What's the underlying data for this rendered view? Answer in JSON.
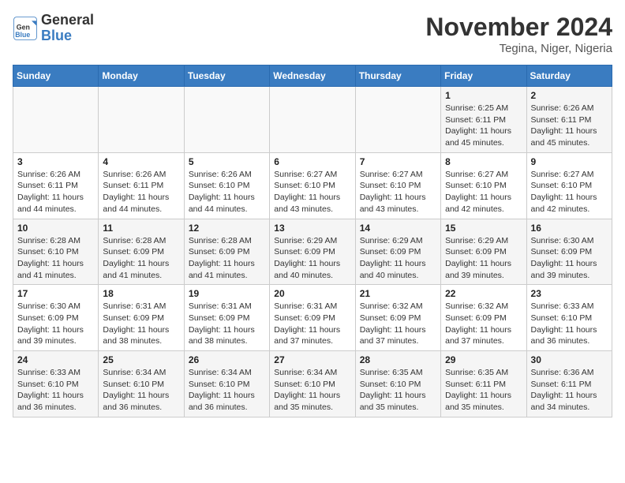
{
  "logo": {
    "general": "General",
    "blue": "Blue"
  },
  "header": {
    "title": "November 2024",
    "location": "Tegina, Niger, Nigeria"
  },
  "weekdays": [
    "Sunday",
    "Monday",
    "Tuesday",
    "Wednesday",
    "Thursday",
    "Friday",
    "Saturday"
  ],
  "weeks": [
    [
      {
        "day": "",
        "info": ""
      },
      {
        "day": "",
        "info": ""
      },
      {
        "day": "",
        "info": ""
      },
      {
        "day": "",
        "info": ""
      },
      {
        "day": "",
        "info": ""
      },
      {
        "day": "1",
        "info": "Sunrise: 6:25 AM\nSunset: 6:11 PM\nDaylight: 11 hours\nand 45 minutes."
      },
      {
        "day": "2",
        "info": "Sunrise: 6:26 AM\nSunset: 6:11 PM\nDaylight: 11 hours\nand 45 minutes."
      }
    ],
    [
      {
        "day": "3",
        "info": "Sunrise: 6:26 AM\nSunset: 6:11 PM\nDaylight: 11 hours\nand 44 minutes."
      },
      {
        "day": "4",
        "info": "Sunrise: 6:26 AM\nSunset: 6:11 PM\nDaylight: 11 hours\nand 44 minutes."
      },
      {
        "day": "5",
        "info": "Sunrise: 6:26 AM\nSunset: 6:10 PM\nDaylight: 11 hours\nand 44 minutes."
      },
      {
        "day": "6",
        "info": "Sunrise: 6:27 AM\nSunset: 6:10 PM\nDaylight: 11 hours\nand 43 minutes."
      },
      {
        "day": "7",
        "info": "Sunrise: 6:27 AM\nSunset: 6:10 PM\nDaylight: 11 hours\nand 43 minutes."
      },
      {
        "day": "8",
        "info": "Sunrise: 6:27 AM\nSunset: 6:10 PM\nDaylight: 11 hours\nand 42 minutes."
      },
      {
        "day": "9",
        "info": "Sunrise: 6:27 AM\nSunset: 6:10 PM\nDaylight: 11 hours\nand 42 minutes."
      }
    ],
    [
      {
        "day": "10",
        "info": "Sunrise: 6:28 AM\nSunset: 6:10 PM\nDaylight: 11 hours\nand 41 minutes."
      },
      {
        "day": "11",
        "info": "Sunrise: 6:28 AM\nSunset: 6:09 PM\nDaylight: 11 hours\nand 41 minutes."
      },
      {
        "day": "12",
        "info": "Sunrise: 6:28 AM\nSunset: 6:09 PM\nDaylight: 11 hours\nand 41 minutes."
      },
      {
        "day": "13",
        "info": "Sunrise: 6:29 AM\nSunset: 6:09 PM\nDaylight: 11 hours\nand 40 minutes."
      },
      {
        "day": "14",
        "info": "Sunrise: 6:29 AM\nSunset: 6:09 PM\nDaylight: 11 hours\nand 40 minutes."
      },
      {
        "day": "15",
        "info": "Sunrise: 6:29 AM\nSunset: 6:09 PM\nDaylight: 11 hours\nand 39 minutes."
      },
      {
        "day": "16",
        "info": "Sunrise: 6:30 AM\nSunset: 6:09 PM\nDaylight: 11 hours\nand 39 minutes."
      }
    ],
    [
      {
        "day": "17",
        "info": "Sunrise: 6:30 AM\nSunset: 6:09 PM\nDaylight: 11 hours\nand 39 minutes."
      },
      {
        "day": "18",
        "info": "Sunrise: 6:31 AM\nSunset: 6:09 PM\nDaylight: 11 hours\nand 38 minutes."
      },
      {
        "day": "19",
        "info": "Sunrise: 6:31 AM\nSunset: 6:09 PM\nDaylight: 11 hours\nand 38 minutes."
      },
      {
        "day": "20",
        "info": "Sunrise: 6:31 AM\nSunset: 6:09 PM\nDaylight: 11 hours\nand 37 minutes."
      },
      {
        "day": "21",
        "info": "Sunrise: 6:32 AM\nSunset: 6:09 PM\nDaylight: 11 hours\nand 37 minutes."
      },
      {
        "day": "22",
        "info": "Sunrise: 6:32 AM\nSunset: 6:09 PM\nDaylight: 11 hours\nand 37 minutes."
      },
      {
        "day": "23",
        "info": "Sunrise: 6:33 AM\nSunset: 6:10 PM\nDaylight: 11 hours\nand 36 minutes."
      }
    ],
    [
      {
        "day": "24",
        "info": "Sunrise: 6:33 AM\nSunset: 6:10 PM\nDaylight: 11 hours\nand 36 minutes."
      },
      {
        "day": "25",
        "info": "Sunrise: 6:34 AM\nSunset: 6:10 PM\nDaylight: 11 hours\nand 36 minutes."
      },
      {
        "day": "26",
        "info": "Sunrise: 6:34 AM\nSunset: 6:10 PM\nDaylight: 11 hours\nand 36 minutes."
      },
      {
        "day": "27",
        "info": "Sunrise: 6:34 AM\nSunset: 6:10 PM\nDaylight: 11 hours\nand 35 minutes."
      },
      {
        "day": "28",
        "info": "Sunrise: 6:35 AM\nSunset: 6:10 PM\nDaylight: 11 hours\nand 35 minutes."
      },
      {
        "day": "29",
        "info": "Sunrise: 6:35 AM\nSunset: 6:11 PM\nDaylight: 11 hours\nand 35 minutes."
      },
      {
        "day": "30",
        "info": "Sunrise: 6:36 AM\nSunset: 6:11 PM\nDaylight: 11 hours\nand 34 minutes."
      }
    ]
  ]
}
